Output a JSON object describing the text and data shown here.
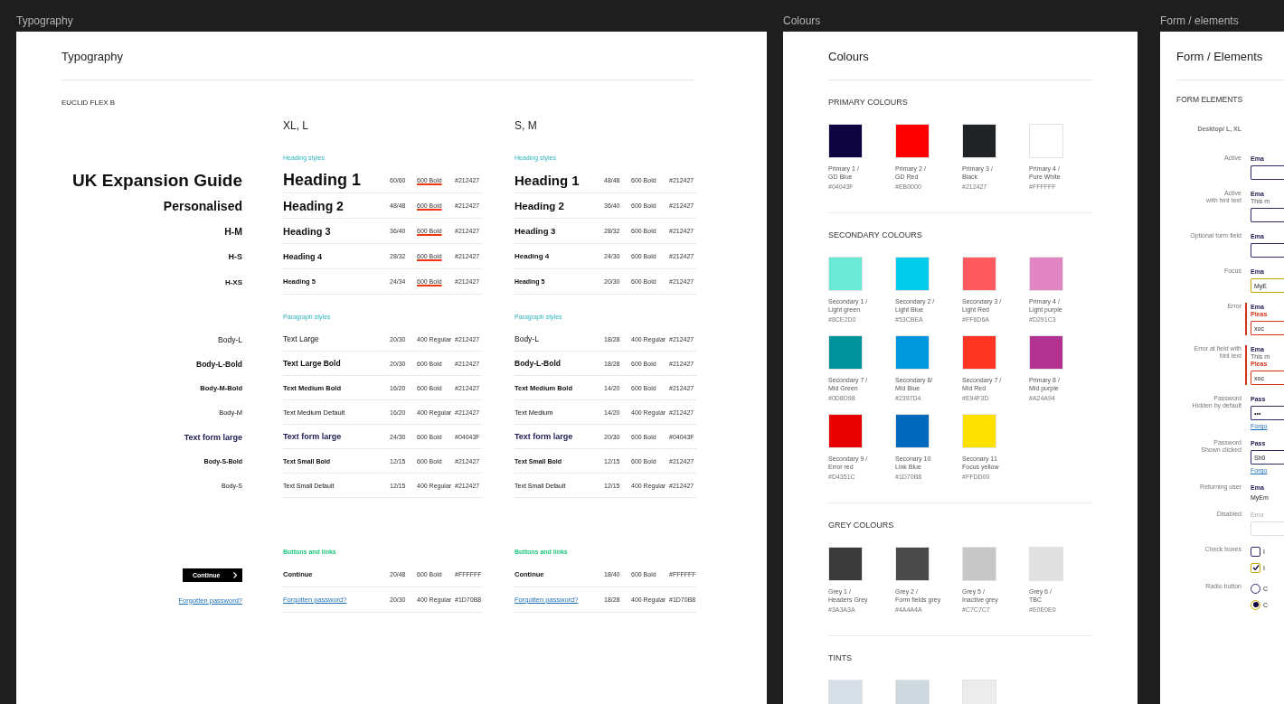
{
  "typography": {
    "frame_label": "Typography",
    "title": "Typography",
    "font_name": "EUCLID FLEX B",
    "columns": [
      "XL, L",
      "S, M"
    ],
    "groups": [
      {
        "kind": "headings",
        "labels": [
          "Heading styles",
          "Heading styles"
        ],
        "rows": [
          {
            "kind": "h1",
            "sample": "UK Expansion Guide",
            "xl": {
              "name": "Heading 1",
              "size": "60/60",
              "weight": "600 Bold",
              "struck": true,
              "hex": "#212427"
            },
            "sm": {
              "name": "Heading 1",
              "size": "48/48",
              "weight": "600 Bold",
              "struck": false,
              "hex": "#212427"
            }
          },
          {
            "kind": "h2",
            "sample": "Personalised",
            "xl": {
              "name": "Heading 2",
              "size": "48/48",
              "weight": "600 Bold",
              "struck": true,
              "hex": "#212427"
            },
            "sm": {
              "name": "Heading 2",
              "size": "36/40",
              "weight": "600 Bold",
              "struck": false,
              "hex": "#212427"
            }
          },
          {
            "kind": "h3",
            "sample": "H-M",
            "xl": {
              "name": "Heading 3",
              "size": "36/40",
              "weight": "600 Bold",
              "struck": true,
              "hex": "#212427"
            },
            "sm": {
              "name": "Heading 3",
              "size": "28/32",
              "weight": "600 Bold",
              "struck": false,
              "hex": "#212427"
            }
          },
          {
            "kind": "h4",
            "sample": "H-S",
            "xl": {
              "name": "Heading 4",
              "size": "28/32",
              "weight": "600 Bold",
              "struck": true,
              "hex": "#212427"
            },
            "sm": {
              "name": "Heading 4",
              "size": "24/30",
              "weight": "600 Bold",
              "struck": false,
              "hex": "#212427"
            }
          },
          {
            "kind": "h5",
            "sample": "H-XS",
            "xl": {
              "name": "Heading 5",
              "size": "24/34",
              "weight": "600 Bold",
              "struck": true,
              "hex": "#212427"
            },
            "sm": {
              "name": "Heading 5",
              "size": "20/30",
              "weight": "600 Bold",
              "struck": false,
              "hex": "#212427"
            }
          }
        ]
      },
      {
        "kind": "paragraphs",
        "labels": [
          "Paragraph styles",
          "Paragraph styles"
        ],
        "rows": [
          {
            "kind": "body-l",
            "sample": "Body-L",
            "xl": {
              "name": "Text Large",
              "size": "20/30",
              "weight": "400 Regular",
              "hex": "#212427"
            },
            "sm": {
              "name": "Body-L",
              "size": "18/28",
              "weight": "400 Regular",
              "hex": "#212427"
            }
          },
          {
            "kind": "body-l-bold",
            "sample": "Body-L-Bold",
            "xl": {
              "name": "Text Large Bold",
              "size": "20/30",
              "weight": "600 Bold",
              "hex": "#212427"
            },
            "sm": {
              "name": "Body-L-Bold",
              "size": "18/28",
              "weight": "600 Bold",
              "hex": "#212427"
            }
          },
          {
            "kind": "body-m-bold",
            "sample": "Body-M-Bold",
            "xl": {
              "name": "Text Medium Bold",
              "size": "16/20",
              "weight": "600 Bold",
              "hex": "#212427"
            },
            "sm": {
              "name": "Text Medium Bold",
              "size": "14/20",
              "weight": "600 Bold",
              "hex": "#212427"
            }
          },
          {
            "kind": "body-m",
            "sample": "Body-M",
            "xl": {
              "name": "Text Medium Default",
              "size": "16/20",
              "weight": "400 Regular",
              "hex": "#212427"
            },
            "sm": {
              "name": "Text Medium",
              "size": "14/20",
              "weight": "400 Regular",
              "hex": "#212427"
            }
          },
          {
            "kind": "form-large",
            "sample": "Text form large",
            "xl": {
              "name": "Text form large",
              "size": "24/30",
              "weight": "600 Bold",
              "hex": "#04043F"
            },
            "sm": {
              "name": "Text form large",
              "size": "20/30",
              "weight": "600 Bold",
              "hex": "#04043F"
            }
          },
          {
            "kind": "body-s-bold",
            "sample": "Body-S-Bold",
            "xl": {
              "name": "Text Small Bold",
              "size": "12/15",
              "weight": "600 Bold",
              "hex": "#212427"
            },
            "sm": {
              "name": "Text Small Bold",
              "size": "12/15",
              "weight": "600 Bold",
              "hex": "#212427"
            }
          },
          {
            "kind": "body-s",
            "sample": "Body-S",
            "xl": {
              "name": "Text Small Default",
              "size": "12/15",
              "weight": "400 Regular",
              "hex": "#212427"
            },
            "sm": {
              "name": "Text Small Default",
              "size": "12/15",
              "weight": "400 Regular",
              "hex": "#212427"
            }
          }
        ]
      },
      {
        "kind": "buttons",
        "labels": [
          "Buttons and links",
          "Buttons and links"
        ],
        "rows": [
          {
            "kind": "button",
            "sample": "Continue",
            "xl": {
              "name": "Continue",
              "size": "20/48",
              "weight": "600 Bold",
              "hex": "#FFFFFF"
            },
            "sm": {
              "name": "Continue",
              "size": "18/40",
              "weight": "600 Bold",
              "hex": "#FFFFFF"
            }
          },
          {
            "kind": "link",
            "sample": "Forgotten password?",
            "xl": {
              "name": "Forgotten password?",
              "size": "20/30",
              "weight": "400 Regular",
              "hex": "#1D70B8"
            },
            "sm": {
              "name": "Forgotten password?",
              "size": "18/28",
              "weight": "400 Regular",
              "hex": "#1D70B8"
            }
          }
        ]
      }
    ]
  },
  "colours": {
    "frame_label": "Colours",
    "title": "Colours",
    "sections": [
      {
        "heading": "PRIMARY COLOURS",
        "swatches": [
          {
            "name": "Primary 1 /",
            "subname": "GD Blue",
            "hex": "#04043F",
            "color": "#0d0440"
          },
          {
            "name": "Primary 2 /",
            "subname": "GD Red",
            "hex": "#EB0000",
            "color": "#ff0000"
          },
          {
            "name": "Primary 3 /",
            "subname": "Black",
            "hex": "#212427",
            "color": "#212427"
          },
          {
            "name": "Primary 4 /",
            "subname": "Pure White",
            "hex": "#FFFFFF",
            "color": "#ffffff"
          }
        ]
      },
      {
        "heading": "SECONDARY COLOURS",
        "swatches": [
          {
            "name": "Secondary 1 /",
            "subname": "Light green",
            "hex": "#8CE2D0",
            "color": "#6ae9d4"
          },
          {
            "name": "Secondary 2 /",
            "subname": "Light Blue",
            "hex": "#53CBEA",
            "color": "#00ccea"
          },
          {
            "name": "Secondary 3 /",
            "subname": "Light Red",
            "hex": "#FF6D6A",
            "color": "#ff5a5f"
          },
          {
            "name": "Primary 4 /",
            "subname": "Light purple",
            "hex": "#D291C3",
            "color": "#e085c2"
          },
          {
            "name": "Secondary 7 /",
            "subname": "Mid Green",
            "hex": "#0D8D98",
            "color": "#00929a"
          },
          {
            "name": "Secondary 6/",
            "subname": "Mid Blue",
            "hex": "#2397D4",
            "color": "#0097db"
          },
          {
            "name": "Secondary 7 /",
            "subname": "Mid Red",
            "hex": "#E94F3D",
            "color": "#ff3524"
          },
          {
            "name": "Primary 8 /",
            "subname": "Mid purple",
            "hex": "#A24A94",
            "color": "#b13290"
          },
          {
            "name": "Secondary 9 /",
            "subname": "Error red",
            "hex": "#D4351C",
            "color": "#e60000"
          },
          {
            "name": "Seconary 10",
            "subname": "Link Blue",
            "hex": "#1D70B8",
            "color": "#0069bb"
          },
          {
            "name": "Seconary 11",
            "subname": "Focus yellow",
            "hex": "#FFDD00",
            "color": "#ffe100"
          }
        ]
      },
      {
        "heading": "GREY COLOURS",
        "swatches": [
          {
            "name": "Grey 1 /",
            "subname": "Headers Grey",
            "hex": "#3A3A3A",
            "color": "#3a3a3a"
          },
          {
            "name": "Grey 2 /",
            "subname": "Form fields grey",
            "hex": "#4A4A4A",
            "color": "#4a4a4a"
          },
          {
            "name": "Grey 5 /",
            "subname": "Inactive grey",
            "hex": "#C7C7C7",
            "color": "#c7c7c7"
          },
          {
            "name": "Grey 6 /",
            "subname": "TBC",
            "hex": "#E0E0E0",
            "color": "#e0e0e0"
          }
        ]
      },
      {
        "heading": "TINTS",
        "swatches": [
          {
            "color": "#d6dee8"
          },
          {
            "color": "#cdd8df"
          },
          {
            "color": "#ececec"
          }
        ]
      }
    ]
  },
  "form": {
    "frame_label": "Form / elements",
    "title": "Form / Elements",
    "heading": "FORM ELEMENTS",
    "breakpoint": "Desktop/ L, XL",
    "rows": [
      {
        "caption": [
          "Active"
        ],
        "kind": "field",
        "label": "Ema"
      },
      {
        "caption": [
          "Active",
          "with hint text"
        ],
        "kind": "field",
        "label": "Ema",
        "hint": "This m"
      },
      {
        "caption": [
          "Optional form field"
        ],
        "kind": "field",
        "label": "Ema"
      },
      {
        "caption": [
          "Focus"
        ],
        "kind": "focus-field",
        "label": "Ema",
        "value": "MyE"
      },
      {
        "caption": [
          "Error"
        ],
        "kind": "error-field",
        "label": "Ema",
        "error": "Pleas",
        "value": "xoc"
      },
      {
        "caption": [
          "Error at field with",
          "hint text"
        ],
        "kind": "error-field",
        "label": "Ema",
        "hint": "This m",
        "error": "Pleas",
        "value": "xoc"
      },
      {
        "caption": [
          "Password",
          "Hidden by default"
        ],
        "kind": "field",
        "label": "Pass",
        "value": "•••",
        "link": "Forgo"
      },
      {
        "caption": [
          "Password",
          "Shown clicked"
        ],
        "kind": "field",
        "label": "Pass",
        "value": "Sh0",
        "link": "Forgo"
      },
      {
        "caption": [
          "Returning user"
        ],
        "kind": "text",
        "label": "Ema",
        "value": "MyEm"
      },
      {
        "caption": [
          "Disabled"
        ],
        "kind": "disabled-field",
        "label": "Ema"
      },
      {
        "caption": [
          "Check boxes"
        ],
        "kind": "checkboxes",
        "options": [
          {
            "label": "I",
            "checked": false
          },
          {
            "label": "I",
            "checked": true
          }
        ]
      },
      {
        "caption": [
          "Radio button"
        ],
        "kind": "radios",
        "options": [
          {
            "label": "C",
            "selected": false
          },
          {
            "label": "C",
            "selected": true
          }
        ]
      }
    ]
  }
}
